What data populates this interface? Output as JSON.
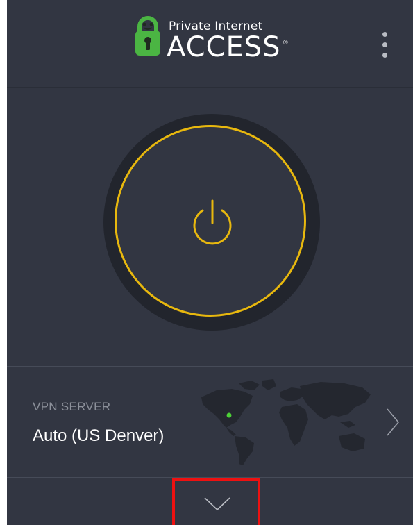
{
  "header": {
    "brand_line1": "Private Internet",
    "brand_line2": "ACCESS",
    "brand_reg": "®",
    "logo_icon": "padlock-robot-logo-icon",
    "menu_icon": "kebab-menu-icon"
  },
  "power": {
    "icon": "power-icon",
    "ring_color": "#e8b80e"
  },
  "server": {
    "label": "VPN SERVER",
    "value": "Auto (US Denver)",
    "map_icon": "world-map-icon",
    "location_dot_color": "#4cd137",
    "chevron_icon": "chevron-right-icon"
  },
  "footer": {
    "expand_icon": "chevron-down-icon",
    "highlight_color": "#ee1111"
  },
  "colors": {
    "background": "#323642",
    "accent": "#e8b80e",
    "brand_green": "#4bb543"
  }
}
